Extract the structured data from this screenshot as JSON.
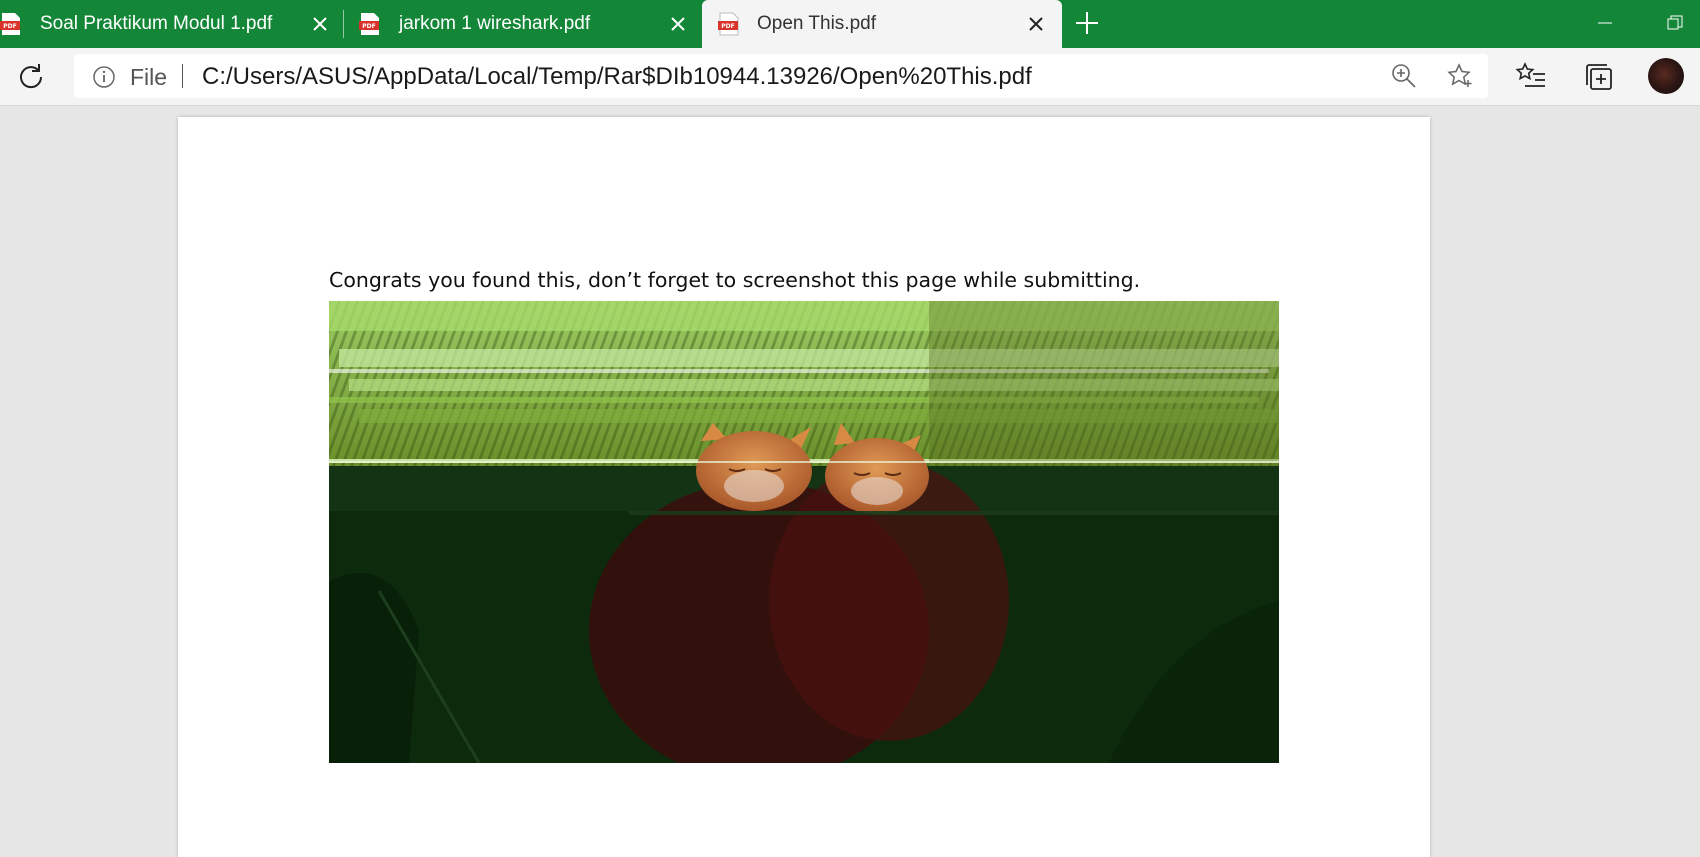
{
  "browser": {
    "tabs": [
      {
        "title": "Soal Praktikum Modul 1.pdf",
        "active": false
      },
      {
        "title": "jarkom 1 wireshark.pdf",
        "active": false
      },
      {
        "title": "Open This.pdf",
        "active": true
      }
    ],
    "address": {
      "scheme_label": "File",
      "url": "C:/Users/ASUS/AppData/Local/Temp/Rar$DIb10944.13926/Open%20This.pdf"
    },
    "icons": {
      "pdf": "pdf-file-icon",
      "close": "close-icon",
      "new_tab": "plus-icon",
      "refresh": "refresh-icon",
      "info": "info-icon",
      "zoom": "zoom-in-icon",
      "favorite": "star-icon",
      "favorites_list": "favorites-list-icon",
      "collections": "collections-icon",
      "minimize": "minimize-icon",
      "restore": "restore-icon"
    },
    "colors": {
      "tabstrip": "#138638",
      "active_tab": "#f4f4f4",
      "pdf_icon": "#d9342b"
    }
  },
  "document": {
    "message": "Congrats you found this, don’t forget to screenshot this page while submitting.",
    "image": {
      "description_icon": "glitched-cat-photo",
      "dominant_colors": [
        "#0c2a0c",
        "#8bc34a",
        "#c47a3d",
        "#4a0f0f"
      ]
    }
  }
}
